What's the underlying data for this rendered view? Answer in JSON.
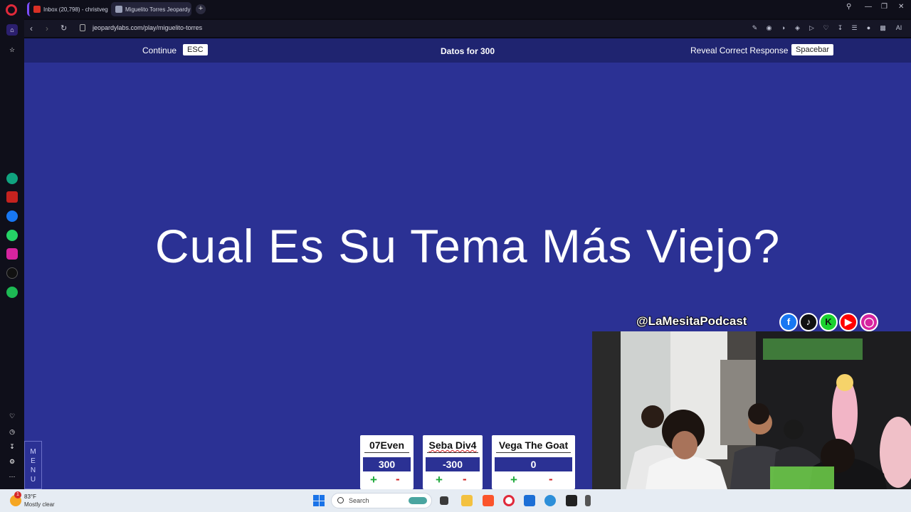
{
  "browser": {
    "tabs": [
      {
        "label": "Inbox (20,798) - christveg",
        "active": false
      },
      {
        "label": "Miguelito Torres Jeopardy",
        "active": true
      }
    ],
    "url": "jeopardylabs.com/play/miguelito-torres"
  },
  "jeopardy": {
    "continue_label": "Continue",
    "esc_key": "ESC",
    "category_title": "Datos for 300",
    "reveal_label": "Reveal Correct Response",
    "reveal_key": "Spacebar",
    "question": "Cual Es Su Tema Más Viejo?",
    "menu_label": [
      "M",
      "E",
      "N",
      "U"
    ],
    "teams": [
      {
        "name": "07Even",
        "score": "300"
      },
      {
        "name": "Seba Div4",
        "score": "-300"
      },
      {
        "name": "Vega The Goat",
        "score": "0"
      }
    ],
    "plus": "+",
    "minus": "-"
  },
  "overlay": {
    "handle": "@LaMesitaPodcast",
    "socials": [
      "facebook-icon",
      "tiktok-icon",
      "kick-icon",
      "youtube-icon",
      "instagram-icon"
    ]
  },
  "taskbar": {
    "temperature": "83°F",
    "condition": "Mostly clear",
    "notification_count": "1",
    "search_placeholder": "Search"
  },
  "colors": {
    "board_blue": "#2b3194",
    "topbar_blue": "#1f2470",
    "plus_green": "#1ea83a",
    "minus_red": "#d02020"
  }
}
